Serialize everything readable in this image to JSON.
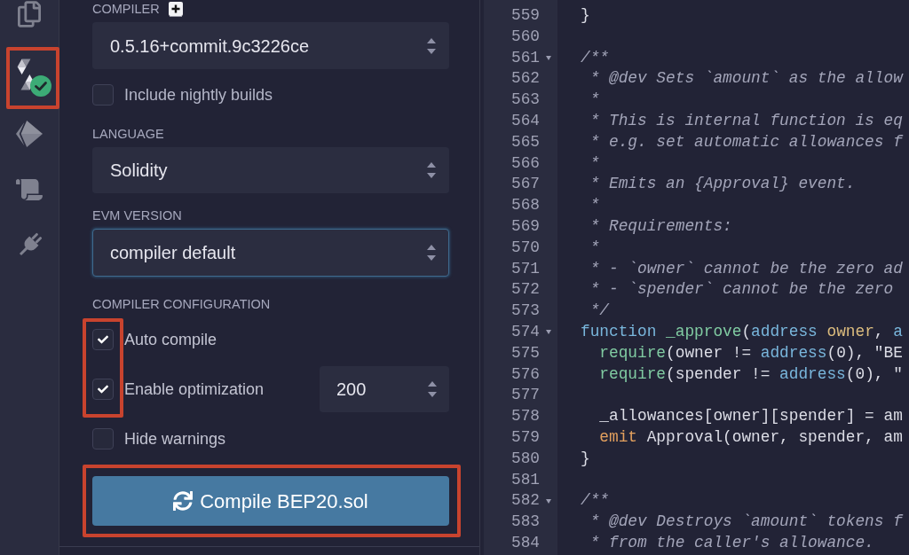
{
  "sidebar": {
    "items": [
      {
        "kind": "files",
        "selected": false,
        "highlighted": false,
        "check_badge": false
      },
      {
        "kind": "compiler",
        "selected": true,
        "highlighted": true,
        "check_badge": true
      },
      {
        "kind": "deploy",
        "selected": false,
        "highlighted": false,
        "check_badge": false
      },
      {
        "kind": "scroll",
        "selected": false,
        "highlighted": false,
        "check_badge": false
      },
      {
        "kind": "plugin",
        "selected": false,
        "highlighted": false,
        "check_badge": false
      }
    ]
  },
  "compiler_panel": {
    "compiler": {
      "label": "COMPILER",
      "select": {
        "value": "0.5.16+commit.9c3226ce",
        "focused": false
      }
    },
    "nightly": {
      "label": "Include nightly builds",
      "checked": false
    },
    "language": {
      "label": "LANGUAGE",
      "select": {
        "value": "Solidity",
        "focused": false
      }
    },
    "evm_version": {
      "label": "EVM VERSION",
      "select": {
        "value": "compiler default",
        "focused": true
      }
    },
    "configuration": {
      "label": "COMPILER CONFIGURATION",
      "options": [
        {
          "kind": "checkbox",
          "label": "Auto compile",
          "checked": true,
          "highlighted": true
        },
        {
          "kind": "checkbox_runs",
          "label": "Enable optimization",
          "checked": true,
          "highlighted": true,
          "runs": "200"
        },
        {
          "kind": "checkbox",
          "label": "Hide warnings",
          "checked": false,
          "highlighted": false
        }
      ]
    },
    "compile_button": {
      "label": "Compile BEP20.sol",
      "highlighted": true
    }
  },
  "editor": {
    "lines": [
      {
        "number": "559",
        "foldable": false,
        "tokens": [
          {
            "kind": "plain",
            "text": "}"
          }
        ]
      },
      {
        "number": "560",
        "foldable": false
      },
      {
        "number": "561",
        "foldable": true,
        "tokens": [
          {
            "kind": "comment",
            "text": "/**"
          }
        ]
      },
      {
        "number": "562",
        "foldable": false,
        "tokens": [
          {
            "kind": "comment",
            "text": " * @dev Sets `amount` as the allow"
          }
        ]
      },
      {
        "number": "563",
        "foldable": false,
        "tokens": [
          {
            "kind": "comment",
            "text": " *"
          }
        ]
      },
      {
        "number": "564",
        "foldable": false,
        "tokens": [
          {
            "kind": "comment",
            "text": " * This is internal function is eq"
          }
        ]
      },
      {
        "number": "565",
        "foldable": false,
        "tokens": [
          {
            "kind": "comment",
            "text": " * e.g. set automatic allowances f"
          }
        ]
      },
      {
        "number": "566",
        "foldable": false,
        "tokens": [
          {
            "kind": "comment",
            "text": " *"
          }
        ]
      },
      {
        "number": "567",
        "foldable": false,
        "tokens": [
          {
            "kind": "comment",
            "text": " * Emits an {Approval} event."
          }
        ]
      },
      {
        "number": "568",
        "foldable": false,
        "tokens": [
          {
            "kind": "comment",
            "text": " *"
          }
        ]
      },
      {
        "number": "569",
        "foldable": false,
        "tokens": [
          {
            "kind": "comment",
            "text": " * Requirements:"
          }
        ]
      },
      {
        "number": "570",
        "foldable": false,
        "tokens": [
          {
            "kind": "comment",
            "text": " *"
          }
        ]
      },
      {
        "number": "571",
        "foldable": false,
        "tokens": [
          {
            "kind": "comment",
            "text": " * - `owner` cannot be the zero ad"
          }
        ]
      },
      {
        "number": "572",
        "foldable": false,
        "tokens": [
          {
            "kind": "comment",
            "text": " * - `spender` cannot be the zero"
          }
        ]
      },
      {
        "number": "573",
        "foldable": false,
        "tokens": [
          {
            "kind": "comment",
            "text": " */"
          }
        ]
      },
      {
        "number": "574",
        "foldable": true,
        "tokens": [
          {
            "kind": "keyword",
            "text": "function"
          },
          {
            "kind": "function",
            "text": " _approve"
          },
          {
            "kind": "plain",
            "text": "("
          },
          {
            "kind": "type",
            "text": "address"
          },
          {
            "kind": "param",
            "text": " owner"
          },
          {
            "kind": "plain",
            "text": ", "
          },
          {
            "kind": "type",
            "text": "a"
          }
        ]
      },
      {
        "number": "575",
        "foldable": false,
        "tokens": [
          {
            "kind": "function",
            "text": "  require"
          },
          {
            "kind": "plain",
            "text": "(owner != "
          },
          {
            "kind": "type",
            "text": "address"
          },
          {
            "kind": "plain",
            "text": "(0), \"BE"
          }
        ]
      },
      {
        "number": "576",
        "foldable": false,
        "tokens": [
          {
            "kind": "function",
            "text": "  require"
          },
          {
            "kind": "plain",
            "text": "(spender != "
          },
          {
            "kind": "type",
            "text": "address"
          },
          {
            "kind": "plain",
            "text": "(0), \""
          }
        ]
      },
      {
        "number": "577",
        "foldable": false
      },
      {
        "number": "578",
        "foldable": false,
        "tokens": [
          {
            "kind": "plain",
            "text": "  _allowances[owner][spender] = am"
          }
        ]
      },
      {
        "number": "579",
        "foldable": false,
        "tokens": [
          {
            "kind": "control",
            "text": "  emit"
          },
          {
            "kind": "plain",
            "text": " Approval(owner, spender, am"
          }
        ]
      },
      {
        "number": "580",
        "foldable": false,
        "tokens": [
          {
            "kind": "plain",
            "text": "}"
          }
        ]
      },
      {
        "number": "581",
        "foldable": false
      },
      {
        "number": "582",
        "foldable": true,
        "tokens": [
          {
            "kind": "comment",
            "text": "/**"
          }
        ]
      },
      {
        "number": "583",
        "foldable": false,
        "tokens": [
          {
            "kind": "comment",
            "text": " * @dev Destroys `amount` tokens f"
          }
        ]
      },
      {
        "number": "584",
        "foldable": false,
        "tokens": [
          {
            "kind": "comment",
            "text": " * from the caller's allowance."
          }
        ]
      }
    ]
  }
}
